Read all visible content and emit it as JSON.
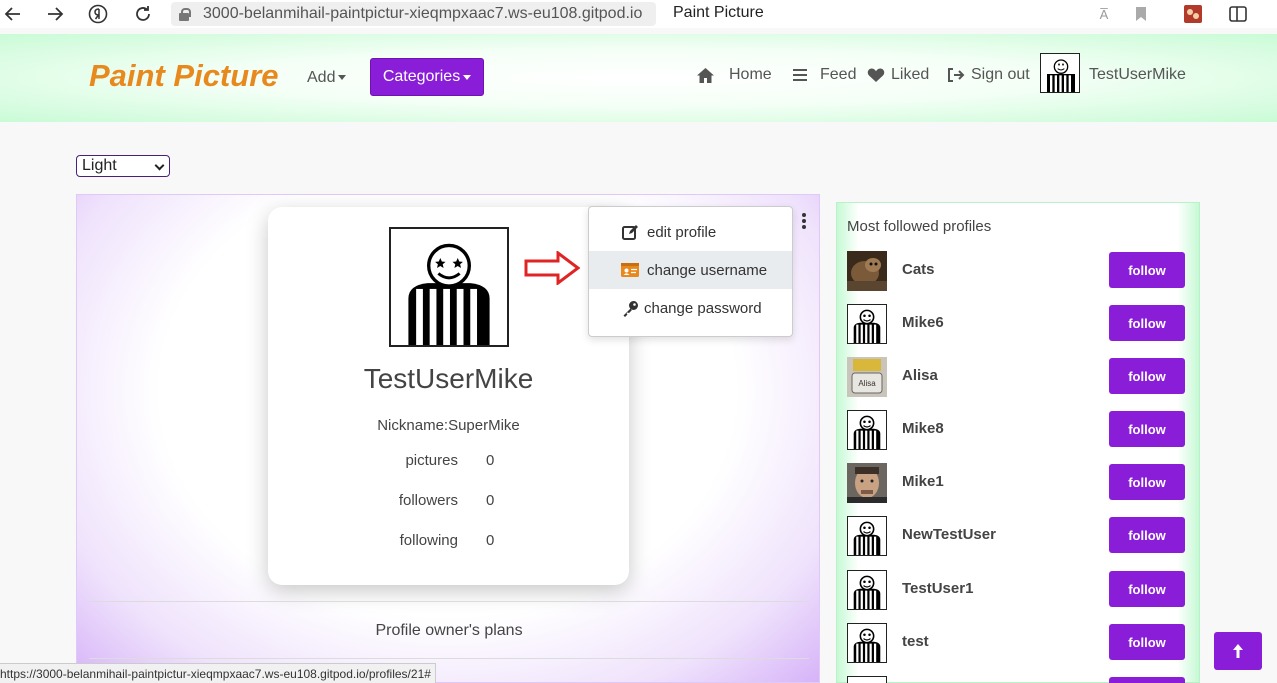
{
  "browser": {
    "url": "3000-belanmihail-paintpictur-xieqmpxaac7.ws-eu108.gitpod.io",
    "tab_title": "Paint Picture",
    "translate_glyph": "A̅"
  },
  "nav": {
    "brand": "Paint Picture",
    "add_label": "Add",
    "categories_label": "Categories",
    "home_label": "Home",
    "feed_label": "Feed",
    "liked_label": "Liked",
    "signout_label": "Sign out",
    "username": "TestUserMike"
  },
  "theme": {
    "selected": "Light"
  },
  "profile": {
    "name": "TestUserMike",
    "nickname": "Nickname:SuperMike",
    "stats": [
      {
        "label": "pictures",
        "value": "0"
      },
      {
        "label": "followers",
        "value": "0"
      },
      {
        "label": "following",
        "value": "0"
      }
    ],
    "plans_label": "Profile owner's plans"
  },
  "menu": {
    "items": [
      {
        "label": "edit profile",
        "icon": "edit-icon"
      },
      {
        "label": "change username",
        "icon": "id-card-icon"
      },
      {
        "label": "change password",
        "icon": "key-icon"
      }
    ]
  },
  "sidebar": {
    "title": "Most followed profiles",
    "follow_label": "follow",
    "profiles": [
      {
        "name": "Cats",
        "avatar": "photo-cat"
      },
      {
        "name": "Mike6",
        "avatar": "referee"
      },
      {
        "name": "Alisa",
        "avatar": "photo-alisa"
      },
      {
        "name": "Mike8",
        "avatar": "referee"
      },
      {
        "name": "Mike1",
        "avatar": "photo-man"
      },
      {
        "name": "NewTestUser",
        "avatar": "referee"
      },
      {
        "name": "TestUser1",
        "avatar": "referee"
      },
      {
        "name": "test",
        "avatar": "referee"
      }
    ]
  },
  "status": {
    "link": "https://3000-belanmihail-paintpictur-xieqmpxaac7.ws-eu108.gitpod.io/profiles/21#"
  },
  "colors": {
    "brand": "#e8891e",
    "accent": "#8a1dd8",
    "arrow": "#e02424"
  }
}
